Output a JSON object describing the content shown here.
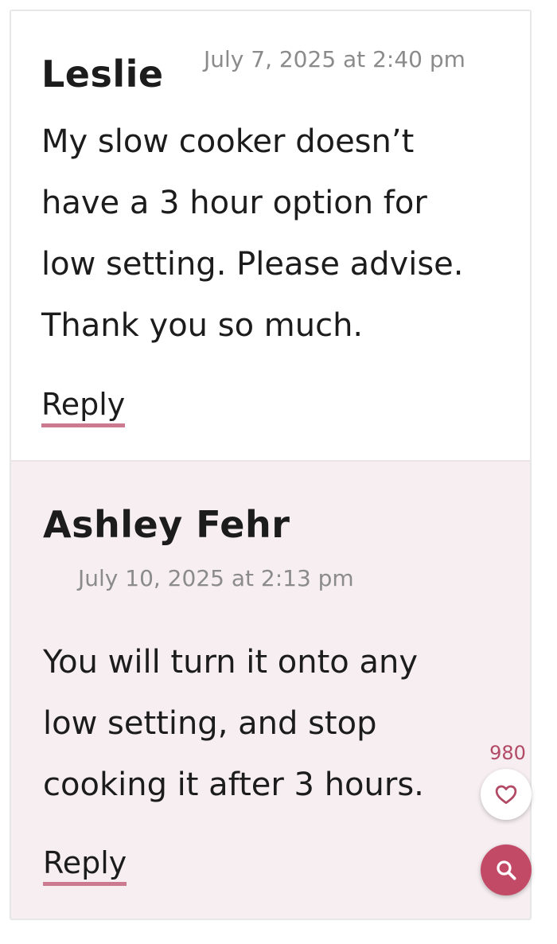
{
  "comments": [
    {
      "author": "Leslie",
      "date": "July 7, 2025 at 2:40 pm",
      "text": "My slow cooker doesn’t\nhave a 3 hour option for\nlow setting. Please advise.\nThank you so much.",
      "reply_label": "Reply"
    },
    {
      "author": "Ashley Fehr",
      "date": "July 10, 2025 at 2:13 pm",
      "text": "You will turn it onto any\nlow setting, and stop\ncooking it after 3 hours.",
      "reply_label": "Reply"
    }
  ],
  "floating_actions": {
    "like_count": "980",
    "like_icon": "heart-icon",
    "search_icon": "search-icon"
  },
  "colors": {
    "accent": "#c24a67",
    "reply_background": "#f6eef0",
    "link_underline": "#cc7a8f"
  }
}
